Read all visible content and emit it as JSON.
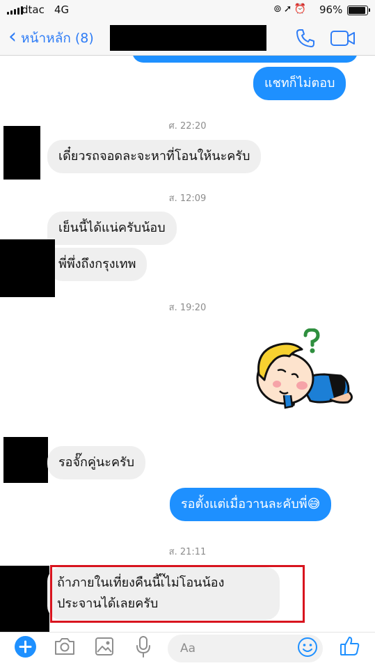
{
  "status_bar": {
    "carrier": "dtac",
    "network": "4G",
    "battery_percent": "96%",
    "battery_level": 0.96,
    "icons": [
      "at-icon",
      "location-arrow-icon",
      "alarm-icon"
    ]
  },
  "header": {
    "back_label": "หน้าหลัก (8)",
    "contact_name": "",
    "icons": [
      "phone-icon",
      "video-icon"
    ],
    "accent_color": "#2f7df6"
  },
  "messages": [
    {
      "side": "out",
      "text": "แชทก็ไม่ตอบ"
    },
    {
      "timestamp": "ศ. 22:20"
    },
    {
      "side": "in",
      "text": "เดี๋ยวรถจอดละจะหาที่โอนให้นะครับ"
    },
    {
      "timestamp": "ส. 12:09"
    },
    {
      "side": "in",
      "text": "เย็นนี้ได้แน่ครับน้อบ"
    },
    {
      "side": "in",
      "text": "พี่พึ่งถึงกรุงเทพ"
    },
    {
      "timestamp": "ส. 19:20"
    },
    {
      "side": "out",
      "sticker": "confused-baby-sticker"
    },
    {
      "side": "in",
      "text": "รอจั๊กคู่นะครับ"
    },
    {
      "side": "out",
      "text": "รอตั้งแต่เมื่อวานละคับพี่😅"
    },
    {
      "timestamp": "ส. 21:11"
    },
    {
      "side": "in",
      "text_lines": [
        "ถ้าภายในเที่ยงคืนนี้เ๊ไม่โอนน้อง",
        "ประจานได้เลยครับ"
      ],
      "highlighted": true
    }
  ],
  "composer": {
    "placeholder": "Aa",
    "icons": [
      "plus-icon",
      "camera-icon",
      "photo-icon",
      "microphone-icon",
      "emoji-icon",
      "thumbs-up-icon"
    ]
  },
  "colors": {
    "outgoing_bubble": "#1e90ff",
    "incoming_bubble": "#efefef",
    "highlight_border": "#d8141e"
  }
}
